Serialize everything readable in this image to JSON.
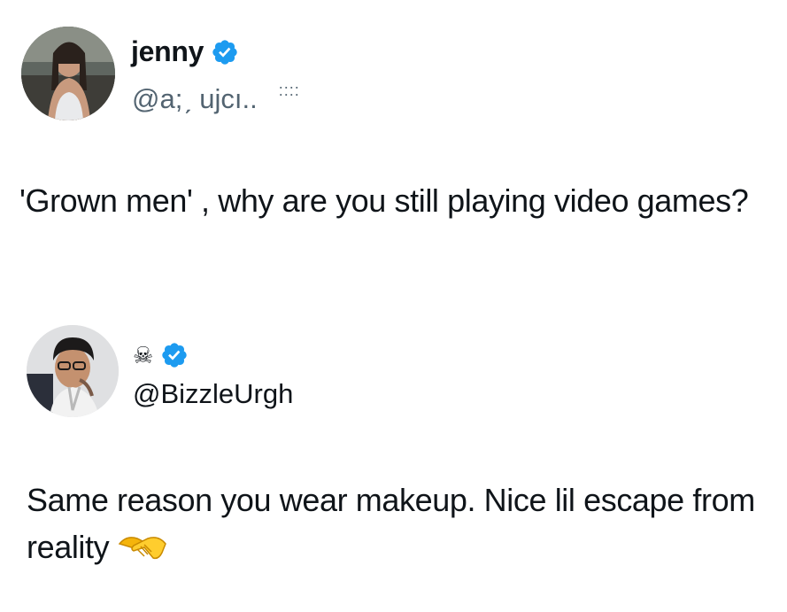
{
  "tweets": [
    {
      "display_name": "jenny",
      "handle": "@a;ˏ ujcı..",
      "handle_extra": "::::",
      "text": "'Grown men' , why are you still playing video games?",
      "verified": true
    },
    {
      "display_name": "☠",
      "handle": "@BizzleUrgh",
      "text": "Same reason you wear makeup. Nice lil escape from reality",
      "emoji": "handshake-emoji",
      "verified": true
    }
  ],
  "colors": {
    "verified_blue": "#1d9bf0",
    "text": "#0f1419",
    "secondary_text": "#536471"
  }
}
